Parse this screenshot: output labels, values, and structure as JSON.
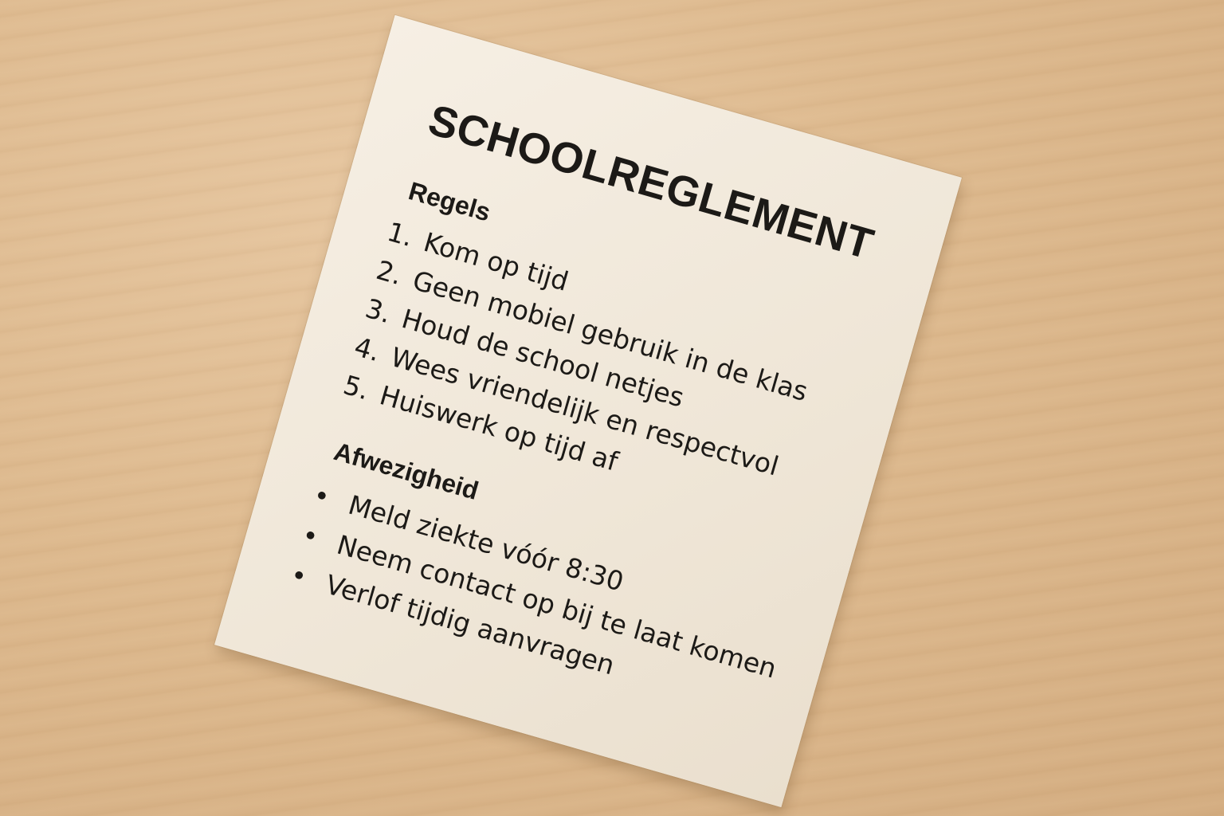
{
  "scene": {
    "surface": "wooden-table",
    "colors": {
      "wood": "#ddb98e",
      "paper": "#f3ebde",
      "ink": "#1c1a17"
    }
  },
  "document": {
    "title": "SCHOOLREGLEMENT",
    "rules": {
      "heading": "Regels",
      "items": [
        {
          "number": "1.",
          "text": "Kom op tijd"
        },
        {
          "number": "2.",
          "text": "Geen mobiel gebruik in de klas"
        },
        {
          "number": "3.",
          "text": "Houd de school netjes"
        },
        {
          "number": "4.",
          "text": "Wees vriendelijk en respectvol"
        },
        {
          "number": "5.",
          "text": "Huiswerk op tijd af"
        }
      ]
    },
    "absence": {
      "heading": "Afwezigheid",
      "bullet": "•",
      "items": [
        {
          "text": "Meld ziekte vóór 8:30"
        },
        {
          "text": "Neem contact op bij te laat komen"
        },
        {
          "text": "Verlof tijdig aanvragen"
        }
      ]
    }
  }
}
